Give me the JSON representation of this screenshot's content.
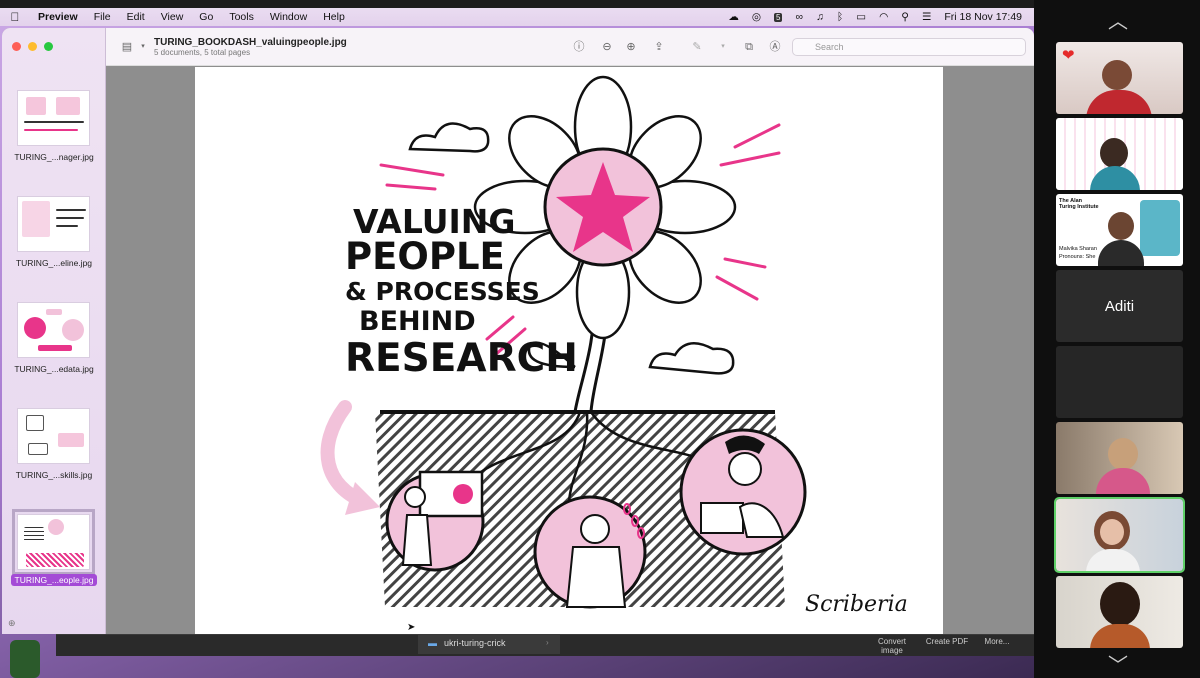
{
  "menubar": {
    "apple": "",
    "items": [
      "Preview",
      "File",
      "Edit",
      "View",
      "Go",
      "Tools",
      "Window",
      "Help"
    ],
    "clock": "Fri 18 Nov  17:49"
  },
  "window": {
    "title": "TURING_BOOKDASH_valuingpeople.jpg",
    "subtitle": "5 documents, 5 total pages",
    "search_placeholder": "Search"
  },
  "sidebar": {
    "items": [
      {
        "label": "TURING_...nager.jpg",
        "selected": false,
        "img_text": "RECOGNISING INVOLVEMENT = DIFFERENT KNOWLEDGE"
      },
      {
        "label": "TURING_...eline.jpg",
        "selected": false,
        "img_text": "THE RATE QUESTION PIPELINE"
      },
      {
        "label": "TURING_...edata.jpg",
        "selected": false,
        "img_text": "THE METADATA"
      },
      {
        "label": "TURING_...skills.jpg",
        "selected": false,
        "img_text": ""
      },
      {
        "label": "TURING_...eople.jpg",
        "selected": true,
        "img_text": "VALUING PEOPLE"
      }
    ]
  },
  "artwork": {
    "line1": "VALUING",
    "line2": "PEOPLE",
    "line3": "& PROCESSES",
    "line4": "BEHIND",
    "line5": "RESEARCH",
    "signature": "Scriberia"
  },
  "dock": {
    "folder": "ukri-turing-crick",
    "actions": [
      "Convert image",
      "Create PDF",
      "More..."
    ]
  },
  "participants": {
    "items": [
      {
        "name": "",
        "has_heart": true
      },
      {
        "name": ""
      },
      {
        "name": "",
        "caption1": "The Alan Turing Institute",
        "caption2": "Malvika Sharan",
        "caption3": "Pronouns: She"
      },
      {
        "name": "Aditi"
      },
      {
        "name": ""
      },
      {
        "name": ""
      },
      {
        "name": ""
      },
      {
        "name": ""
      }
    ]
  },
  "colors": {
    "accent_pink": "#e8358a",
    "light_pink": "#f2c2da",
    "selection_purple": "#a44bd6",
    "active_speaker": "#5fd068"
  }
}
